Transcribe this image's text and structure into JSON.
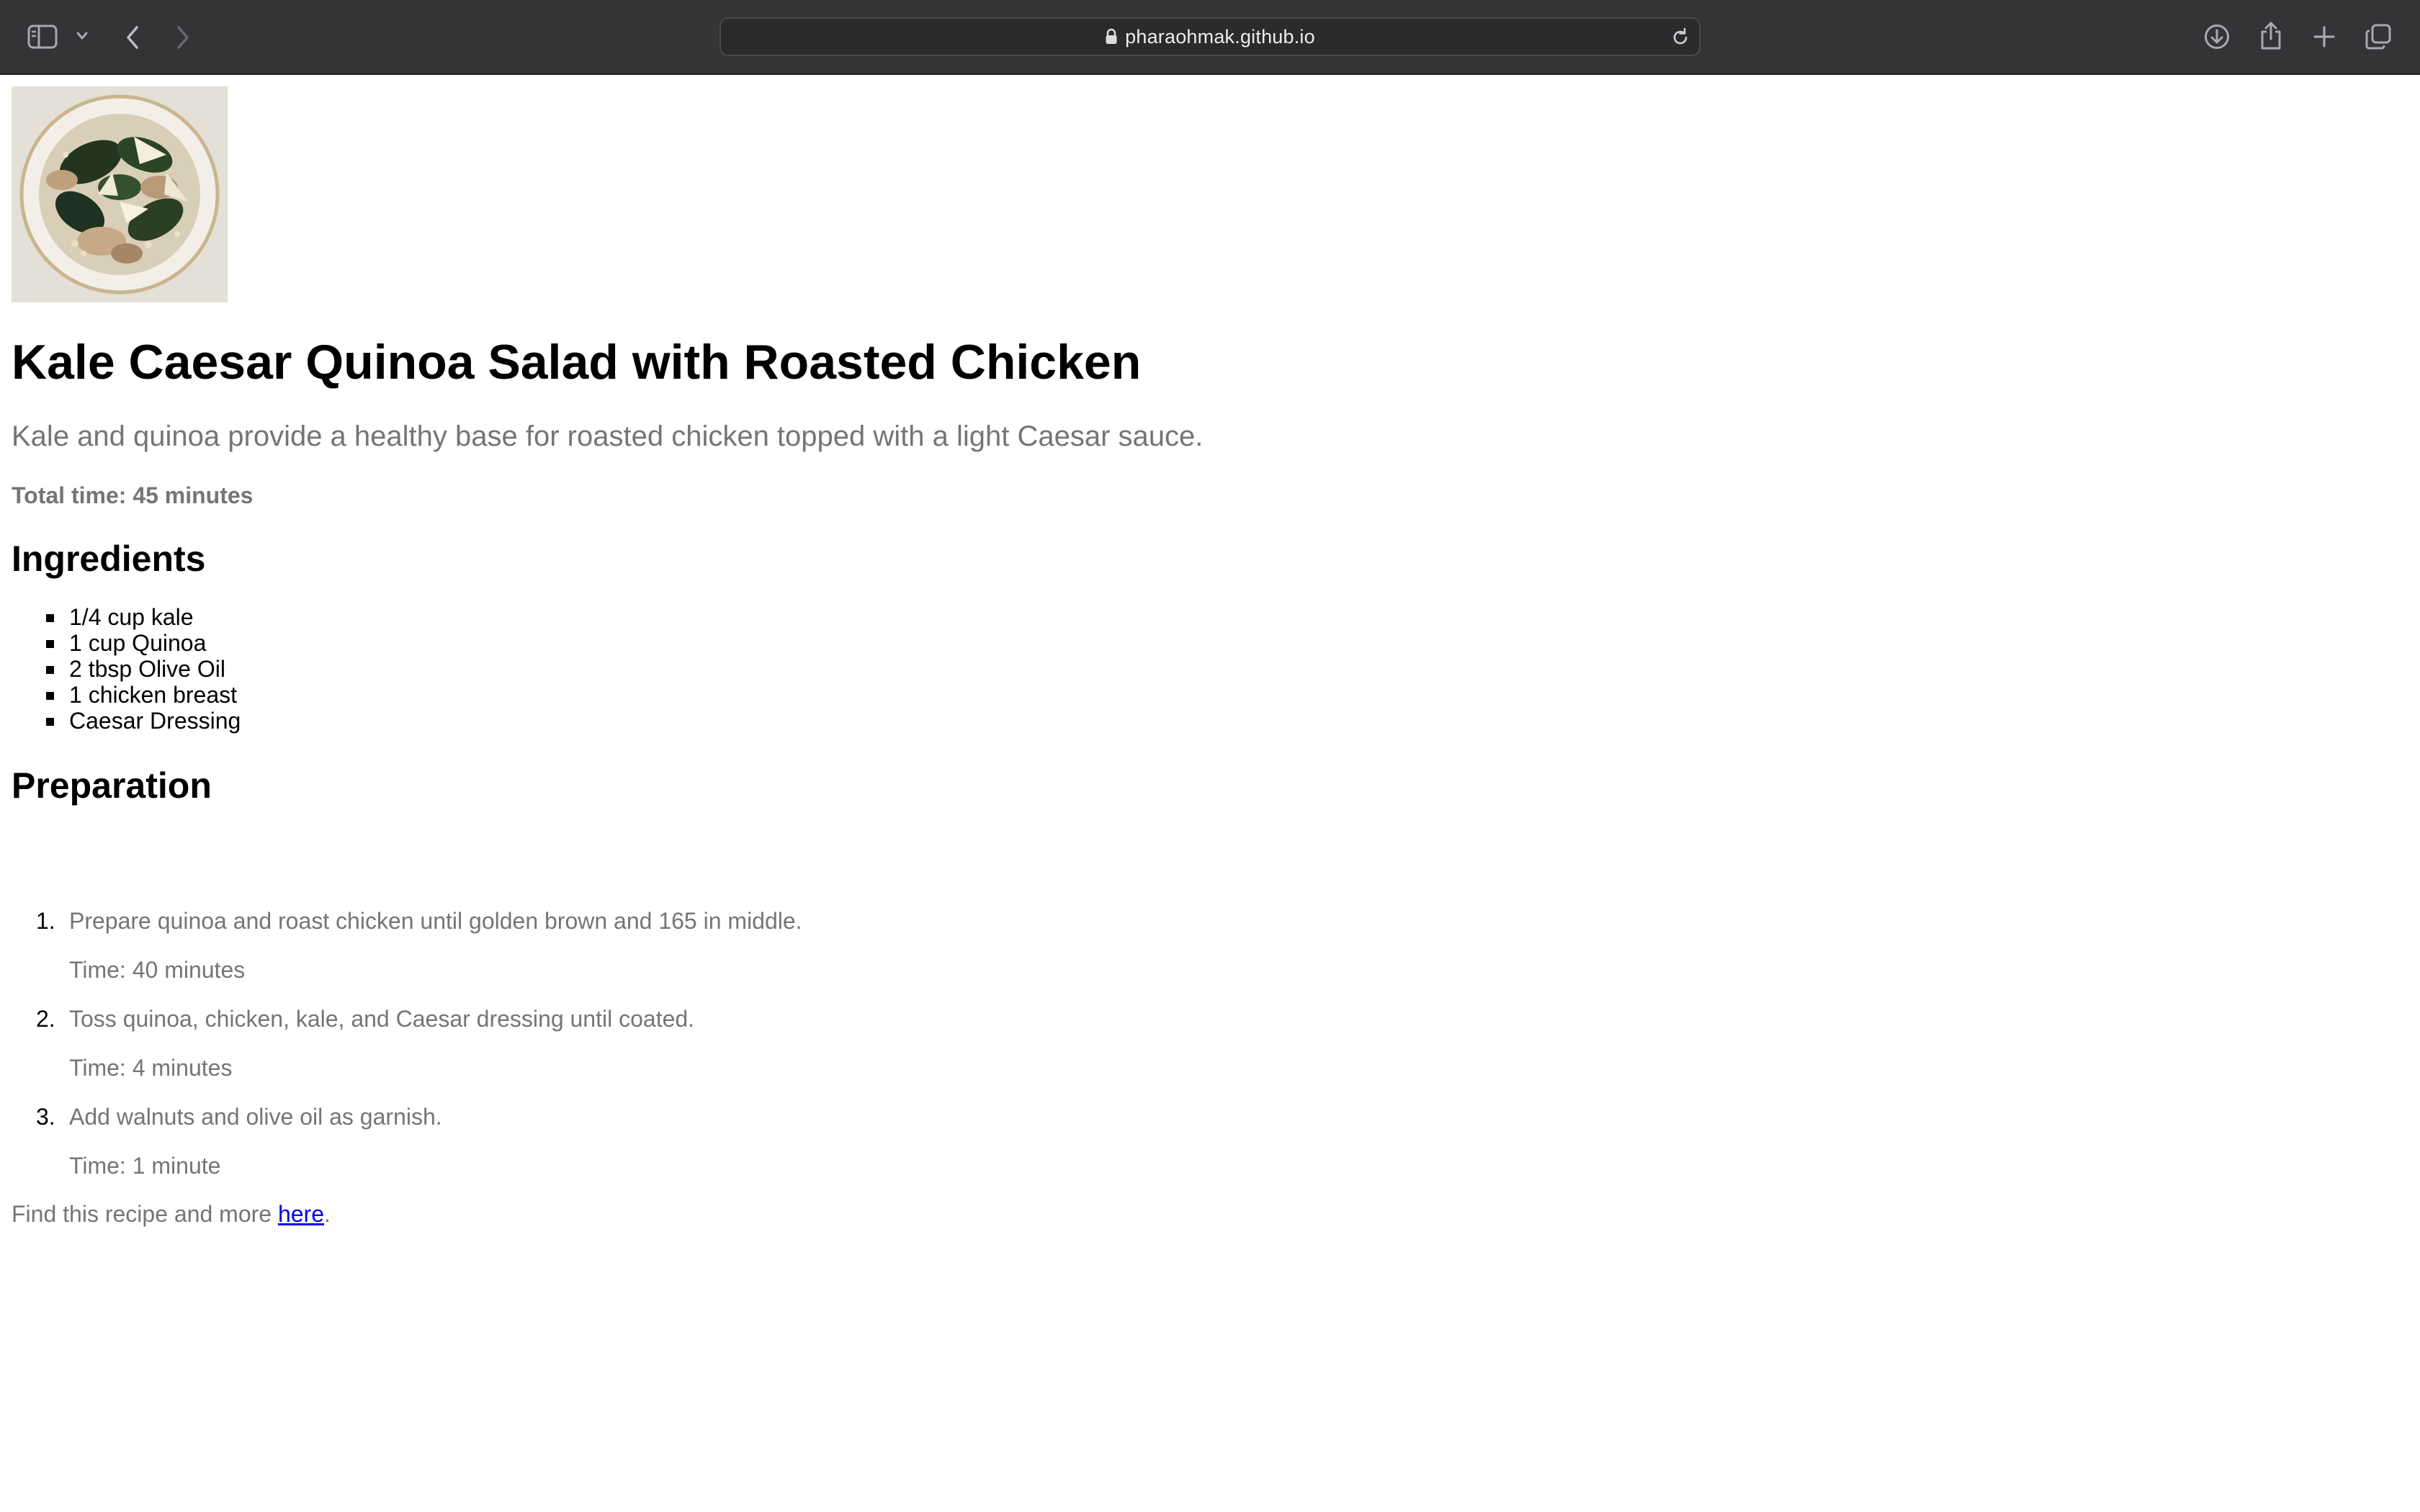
{
  "browser": {
    "url": "pharaohmak.github.io",
    "icons": {
      "sidebar": "sidebar-icon",
      "sidebar_menu": "chevron-down-icon",
      "back": "chevron-left-icon",
      "forward": "chevron-right-icon",
      "lock": "lock-icon",
      "reload": "reload-icon",
      "downloads": "download-icon",
      "share": "share-icon",
      "new_tab": "plus-icon",
      "tabs_overview": "tabs-icon"
    }
  },
  "recipe": {
    "title": "Kale Caesar Quinoa Salad with Roasted Chicken",
    "description": "Kale and quinoa provide a healthy base for roasted chicken topped with a light Caesar sauce.",
    "total_time": "Total time: 45 minutes",
    "ingredients_heading": "Ingredients",
    "ingredients": [
      "1/4 cup kale",
      "1 cup Quinoa",
      "2 tbsp Olive Oil",
      "1 chicken breast",
      "Caesar Dressing"
    ],
    "preparation_heading": "Preparation",
    "steps": [
      {
        "number": "1.",
        "text": "Prepare quinoa and roast chicken until golden brown and 165 in middle.",
        "time": "Time: 40 minutes"
      },
      {
        "number": "2.",
        "text": "Toss quinoa, chicken, kale, and Caesar dressing until coated.",
        "time": "Time: 4 minutes"
      },
      {
        "number": "3.",
        "text": "Add walnuts and olive oil as garnish.",
        "time": "Time: 1 minute"
      }
    ],
    "footer": {
      "prefix": "Find this recipe and more ",
      "link_text": "here",
      "suffix": "."
    }
  },
  "colors": {
    "toolbar_bg": "#343437",
    "muted_text": "#757575",
    "link": "#0000ee"
  }
}
